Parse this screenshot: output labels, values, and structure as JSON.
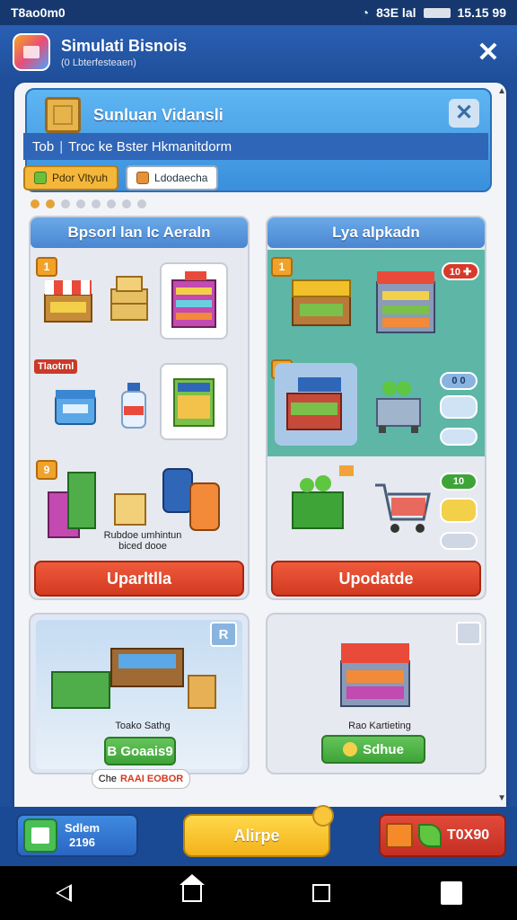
{
  "status": {
    "carrier": "T8ao0m0",
    "center": "83E lal",
    "time": "15.15 99"
  },
  "app": {
    "title": "Simulati Bisnois",
    "subtitle": "(0 Lbterfesteaen)",
    "close_glyph": "✕"
  },
  "dialog": {
    "title": "Sunluan Vidansli",
    "close_glyph": "✕",
    "tab_left": "Tob",
    "tab_sep": "|",
    "tab_right": "Troc ke Bster Hkmanitdorm",
    "chip_primary": "Pdor Vltyuh",
    "chip_secondary": "Ldodaecha"
  },
  "left_card": {
    "title": "Bpsorl lan Ic Aeraln",
    "row1_badge": "1",
    "row2_label": "Tlaotrnl",
    "row3_badge": "9",
    "row3_caption": "Rubdoe umhintun\nbiced dooe",
    "action": "Uparltlla"
  },
  "right_card": {
    "title": "Lya alpkadn",
    "row1_badge": "1",
    "row1_pill": "10 ✚",
    "row2_badge": "1",
    "row2_pill_top": "0 0",
    "row3_pill": "10",
    "action": "Upodatde"
  },
  "bottom_left_card": {
    "corner": "R",
    "caption": "Toako Sathg",
    "button": "B Goaais9",
    "footer_label_a": "Che",
    "footer_label_b": "RAAI EOBOR"
  },
  "bottom_right_card": {
    "caption": "Rao Kartieting",
    "button": "Sdhue"
  },
  "bottom_bar": {
    "stat_label": "Sdlem",
    "stat_value": "2196",
    "main_button": "Alirpe",
    "cash_value": "T0X90"
  },
  "colors": {
    "brand_blue": "#1f4f9a",
    "accent_orange": "#f2b21a",
    "action_red": "#d23a22",
    "ok_green": "#3ea438"
  }
}
